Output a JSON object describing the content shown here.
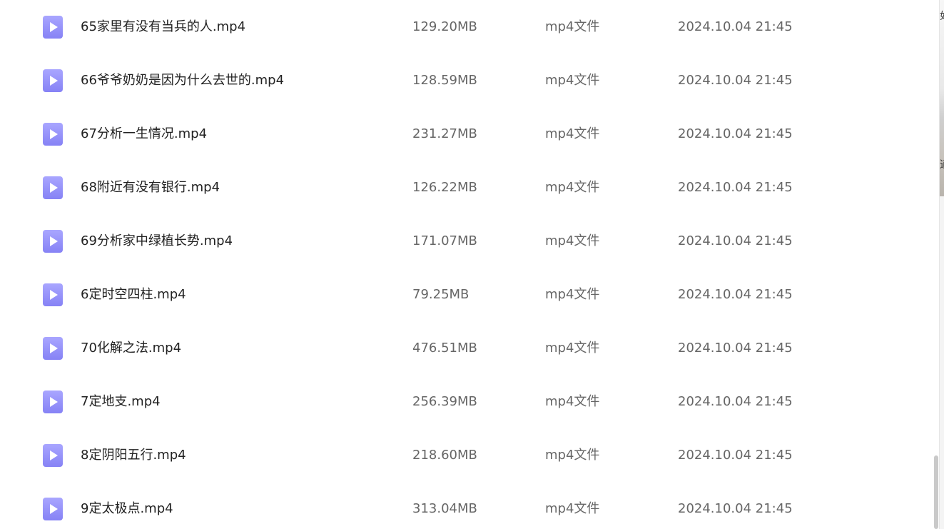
{
  "files": [
    {
      "name": "65家里有没有当兵的人.mp4",
      "size": "129.20MB",
      "type": "mp4文件",
      "date": "2024.10.04 21:45"
    },
    {
      "name": "66爷爷奶奶是因为什么去世的.mp4",
      "size": "128.59MB",
      "type": "mp4文件",
      "date": "2024.10.04 21:45"
    },
    {
      "name": "67分析一生情况.mp4",
      "size": "231.27MB",
      "type": "mp4文件",
      "date": "2024.10.04 21:45"
    },
    {
      "name": "68附近有没有银行.mp4",
      "size": "126.22MB",
      "type": "mp4文件",
      "date": "2024.10.04 21:45"
    },
    {
      "name": "69分析家中绿植长势.mp4",
      "size": "171.07MB",
      "type": "mp4文件",
      "date": "2024.10.04 21:45"
    },
    {
      "name": "6定时空四柱.mp4",
      "size": "79.25MB",
      "type": "mp4文件",
      "date": "2024.10.04 21:45"
    },
    {
      "name": "70化解之法.mp4",
      "size": "476.51MB",
      "type": "mp4文件",
      "date": "2024.10.04 21:45"
    },
    {
      "name": "7定地支.mp4",
      "size": "256.39MB",
      "type": "mp4文件",
      "date": "2024.10.04 21:45"
    },
    {
      "name": "8定阴阳五行.mp4",
      "size": "218.60MB",
      "type": "mp4文件",
      "date": "2024.10.04 21:45"
    },
    {
      "name": "9定太极点.mp4",
      "size": "313.04MB",
      "type": "mp4文件",
      "date": "2024.10.04 21:45"
    }
  ],
  "icon": {
    "name": "video-file-icon",
    "color": "#8f8bf7"
  },
  "side_peek": {
    "glyph_top": "如",
    "glyph_bottom": "道"
  }
}
